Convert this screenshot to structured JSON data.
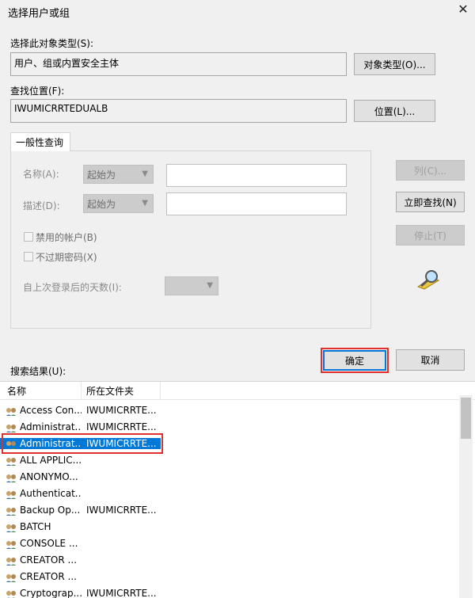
{
  "window": {
    "title": "选择用户或组",
    "close_glyph": "✕"
  },
  "object_types": {
    "label": "选择此对象类型(S):",
    "value": "用户、组或内置安全主体",
    "button": "对象类型(O)..."
  },
  "location": {
    "label": "查找位置(F):",
    "value": "IWUMICRRTEDUALB",
    "button": "位置(L)..."
  },
  "query": {
    "tab": "一般性查询",
    "name_label": "名称(A):",
    "name_combo": "起始为",
    "desc_label": "描述(D):",
    "desc_combo": "起始为",
    "disabled_accounts": "禁用的帐户(B)",
    "non_expiring_pw": "不过期密码(X)",
    "days_label": "自上次登录后的天数(I):"
  },
  "side_buttons": {
    "columns": "列(C)...",
    "find_now": "立即查找(N)",
    "stop": "停止(T)"
  },
  "actions": {
    "ok": "确定",
    "cancel": "取消"
  },
  "results": {
    "label": "搜索结果(U):",
    "columns": [
      "名称",
      "所在文件夹"
    ],
    "rows": [
      {
        "name": "Access Con...",
        "folder": "IWUMICRRTE..."
      },
      {
        "name": "Administrat...",
        "folder": "IWUMICRRTE..."
      },
      {
        "name": "Administrat...",
        "folder": "IWUMICRRTE...",
        "selected": true
      },
      {
        "name": "ALL APPLIC...",
        "folder": ""
      },
      {
        "name": "ANONYMO...",
        "folder": ""
      },
      {
        "name": "Authenticat...",
        "folder": ""
      },
      {
        "name": "Backup Op...",
        "folder": "IWUMICRRTE..."
      },
      {
        "name": "BATCH",
        "folder": ""
      },
      {
        "name": "CONSOLE ...",
        "folder": ""
      },
      {
        "name": "CREATOR ...",
        "folder": ""
      },
      {
        "name": "CREATOR ...",
        "folder": ""
      },
      {
        "name": "Cryptograp...",
        "folder": "IWUMICRRTE..."
      }
    ]
  },
  "colors": {
    "selection": "#0078d7",
    "highlight_box": "#e0302d",
    "accent": "#0078d7"
  }
}
